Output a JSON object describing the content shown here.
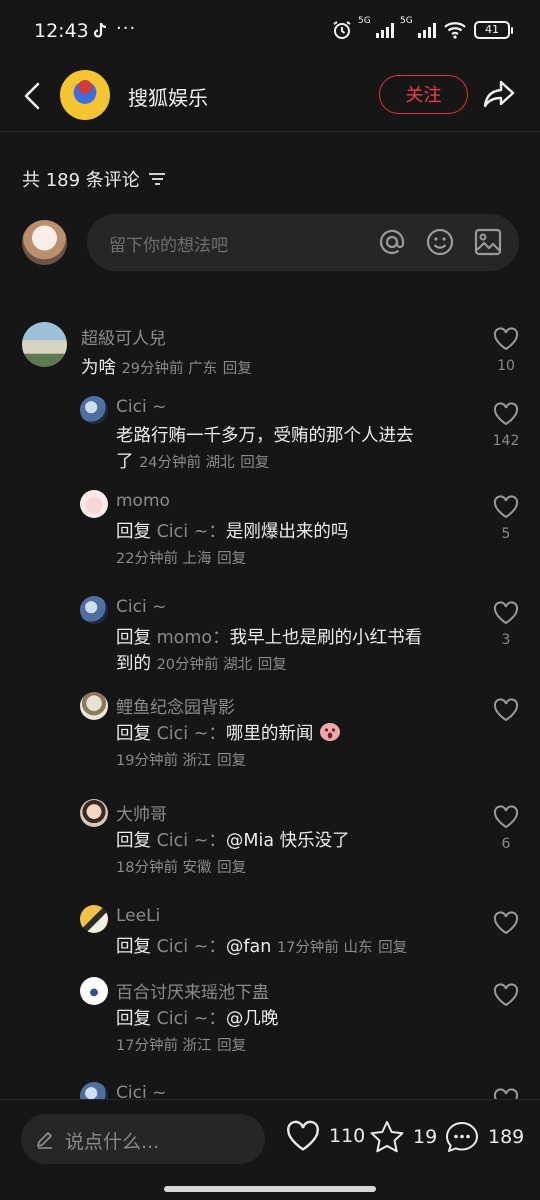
{
  "status": {
    "time": "12:43",
    "battery": "41",
    "network_1": "5G",
    "network_2": "5G"
  },
  "header": {
    "channel_name": "搜狐娱乐",
    "follow_label": "关注"
  },
  "comments_header": {
    "count_text": "共 189 条评论"
  },
  "input": {
    "placeholder": "留下你的想法吧"
  },
  "comments": [
    {
      "name": "超級可人兒",
      "text": "为啥",
      "meta": "29分钟前 广东",
      "reply": "回复",
      "likes": "10"
    },
    {
      "name": "Cici ~",
      "text": "老路行贿一千多万，受贿的那个人进去",
      "text2": "了",
      "meta": "24分钟前 湖北",
      "reply": "回复",
      "likes": "142"
    },
    {
      "name": "momo",
      "reply_label": "回复",
      "ref": "Cici ~：",
      "text": "是刚爆出来的吗",
      "meta": "22分钟前 上海",
      "reply": "回复",
      "likes": "5"
    },
    {
      "name": "Cici ~",
      "reply_label": "回复",
      "ref": "momo：",
      "text": "我早上也是刷的小红书看",
      "text2": "到的",
      "meta": "20分钟前 湖北",
      "reply": "回复",
      "likes": "3"
    },
    {
      "name": "鲤鱼纪念园背影",
      "reply_label": "回复",
      "ref": "Cici ~：",
      "text": "哪里的新闻",
      "meta": "19分钟前 浙江",
      "reply": "回复",
      "likes": ""
    },
    {
      "name": "大帅哥",
      "reply_label": "回复",
      "ref": "Cici ~：",
      "text": "@Mia  快乐没了",
      "meta": "18分钟前 安徽",
      "reply": "回复",
      "likes": "6"
    },
    {
      "name": "LeeLi",
      "reply_label": "回复",
      "ref": "Cici ~：",
      "text": "@fan",
      "meta": "17分钟前 山东",
      "reply": "回复",
      "likes": ""
    },
    {
      "name": "百合讨厌来瑶池下蛊",
      "reply_label": "回复",
      "ref": "Cici ~：",
      "text": "@几晚",
      "meta": "17分钟前 浙江",
      "reply": "回复",
      "likes": ""
    },
    {
      "name": "Cici ~"
    }
  ],
  "bottom": {
    "say_placeholder": "说点什么...",
    "likes": "110",
    "favorites": "19",
    "comments": "189"
  },
  "colors": {
    "background": "#161616",
    "accent": "#f23a55",
    "muted": "#8a8a8a"
  },
  "icons": [
    "back-arrow-icon",
    "share-icon",
    "sort-icon",
    "at-icon",
    "emoji-icon",
    "image-icon",
    "heart-icon",
    "star-icon",
    "comment-icon",
    "pen-icon"
  ]
}
